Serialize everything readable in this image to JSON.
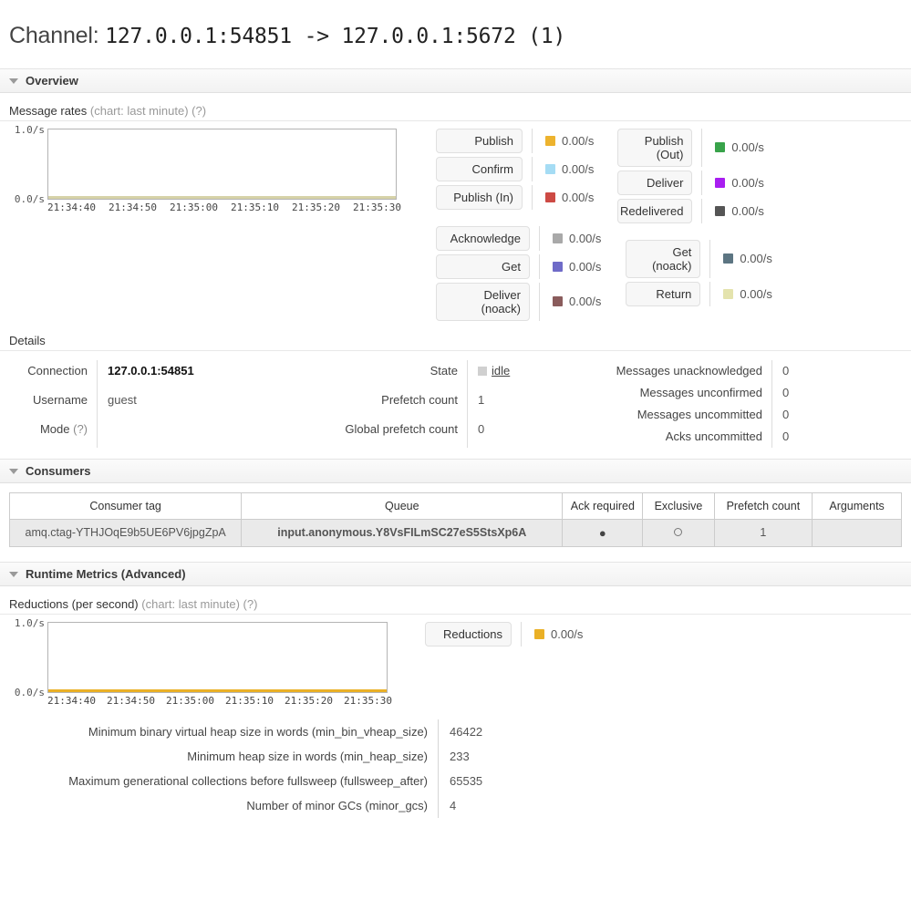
{
  "page": {
    "title_prefix": "Channel:",
    "title_value": "127.0.0.1:54851 -> 127.0.0.1:5672 (1)"
  },
  "sections": {
    "overview": "Overview",
    "consumers": "Consumers",
    "runtime": "Runtime Metrics (Advanced)"
  },
  "message_rates": {
    "heading": "Message rates",
    "chart_note": "(chart: last minute)",
    "help": "(?)"
  },
  "reductions": {
    "heading": "Reductions (per second)",
    "chart_note": "(chart: last minute)",
    "help": "(?)",
    "button": "Reductions",
    "value": "0.00/s",
    "color": "#eab026"
  },
  "rate_legend": {
    "col1_group1": [
      {
        "label": "Publish",
        "value": "0.00/s",
        "color": "#edb32e"
      },
      {
        "label": "Confirm",
        "value": "0.00/s",
        "color": "#a5dcf4"
      },
      {
        "label": "Publish (In)",
        "value": "0.00/s",
        "color": "#cd4a44"
      }
    ],
    "col1_group2": [
      {
        "label": "Acknowledge",
        "value": "0.00/s",
        "color": "#a9a9a9"
      },
      {
        "label": "Get",
        "value": "0.00/s",
        "color": "#6f6bc8"
      },
      {
        "label": "Deliver\n(noack)",
        "value": "0.00/s",
        "color": "#8a5c5c"
      }
    ],
    "col2_group1": [
      {
        "label": "Publish\n(Out)",
        "value": "0.00/s",
        "color": "#38a34a"
      },
      {
        "label": "Deliver",
        "value": "0.00/s",
        "color": "#a81ef0"
      },
      {
        "label": "Redelivered",
        "value": "0.00/s",
        "color": "#555555"
      }
    ],
    "col2_group2": [
      {
        "label": "Get\n(noack)",
        "value": "0.00/s",
        "color": "#5c7582"
      },
      {
        "label": "Return",
        "value": "0.00/s",
        "color": "#e4e3ad"
      }
    ]
  },
  "details": {
    "heading": "Details",
    "col1": [
      {
        "label": "Connection",
        "value": "127.0.0.1:54851",
        "strong": true
      },
      {
        "label": "Username",
        "value": "guest",
        "strong": false
      },
      {
        "label": "Mode",
        "hint": "(?)",
        "value": "",
        "strong": false
      }
    ],
    "col2": [
      {
        "label": "State",
        "value": "idle",
        "is_state": true
      },
      {
        "label": "Prefetch count",
        "value": "1"
      },
      {
        "label": "Global prefetch count",
        "value": "0"
      }
    ],
    "col3": [
      {
        "label": "Messages unacknowledged",
        "value": "0"
      },
      {
        "label": "Messages unconfirmed",
        "value": "0"
      },
      {
        "label": "Messages uncommitted",
        "value": "0"
      },
      {
        "label": "Acks uncommitted",
        "value": "0"
      }
    ]
  },
  "consumers_table": {
    "headers": [
      "Consumer tag",
      "Queue",
      "Ack required",
      "Exclusive",
      "Prefetch count",
      "Arguments"
    ],
    "rows": [
      {
        "consumer_tag": "amq.ctag-YTHJOqE9b5UE6PV6jpgZpA",
        "queue": "input.anonymous.Y8VsFILmSC27eS5StsXp6A",
        "ack_required": "●",
        "exclusive": "○",
        "prefetch_count": "1",
        "arguments": ""
      }
    ]
  },
  "runtime_metrics": [
    {
      "label": "Minimum binary virtual heap size in words (min_bin_vheap_size)",
      "value": "46422"
    },
    {
      "label": "Minimum heap size in words (min_heap_size)",
      "value": "233"
    },
    {
      "label": "Maximum generational collections before fullsweep (fullsweep_after)",
      "value": "65535"
    },
    {
      "label": "Number of minor GCs (minor_gcs)",
      "value": "4"
    }
  ],
  "chart_data": [
    {
      "type": "line",
      "title": "Message rates",
      "xlabel": "",
      "ylabel": "",
      "ylim": [
        0.0,
        1.0
      ],
      "ytick_labels": [
        "1.0/s",
        "0.0/s"
      ],
      "xtick_labels": [
        "21:34:40",
        "21:34:50",
        "21:35:00",
        "21:35:10",
        "21:35:20",
        "21:35:30"
      ],
      "grid": false,
      "legend_position": "right",
      "series": [
        {
          "name": "Publish",
          "color": "#edb32e",
          "values": [
            0,
            0,
            0,
            0,
            0,
            0
          ]
        },
        {
          "name": "Confirm",
          "color": "#a5dcf4",
          "values": [
            0,
            0,
            0,
            0,
            0,
            0
          ]
        },
        {
          "name": "Publish (In)",
          "color": "#cd4a44",
          "values": [
            0,
            0,
            0,
            0,
            0,
            0
          ]
        },
        {
          "name": "Publish (Out)",
          "color": "#38a34a",
          "values": [
            0,
            0,
            0,
            0,
            0,
            0
          ]
        },
        {
          "name": "Deliver",
          "color": "#a81ef0",
          "values": [
            0,
            0,
            0,
            0,
            0,
            0
          ]
        },
        {
          "name": "Redelivered",
          "color": "#555555",
          "values": [
            0,
            0,
            0,
            0,
            0,
            0
          ]
        },
        {
          "name": "Acknowledge",
          "color": "#a9a9a9",
          "values": [
            0,
            0,
            0,
            0,
            0,
            0
          ]
        },
        {
          "name": "Get",
          "color": "#6f6bc8",
          "values": [
            0,
            0,
            0,
            0,
            0,
            0
          ]
        },
        {
          "name": "Get (noack)",
          "color": "#5c7582",
          "values": [
            0,
            0,
            0,
            0,
            0,
            0
          ]
        },
        {
          "name": "Deliver (noack)",
          "color": "#8a5c5c",
          "values": [
            0,
            0,
            0,
            0,
            0,
            0
          ]
        },
        {
          "name": "Return",
          "color": "#e4e3ad",
          "values": [
            0,
            0,
            0,
            0,
            0,
            0
          ]
        }
      ]
    },
    {
      "type": "line",
      "title": "Reductions (per second)",
      "xlabel": "",
      "ylabel": "",
      "ylim": [
        0.0,
        1.0
      ],
      "ytick_labels": [
        "1.0/s",
        "0.0/s"
      ],
      "xtick_labels": [
        "21:34:40",
        "21:34:50",
        "21:35:00",
        "21:35:10",
        "21:35:20",
        "21:35:30"
      ],
      "grid": false,
      "legend_position": "right",
      "series": [
        {
          "name": "Reductions",
          "color": "#eab026",
          "values": [
            0,
            0,
            0,
            0,
            0,
            0
          ]
        }
      ]
    }
  ]
}
